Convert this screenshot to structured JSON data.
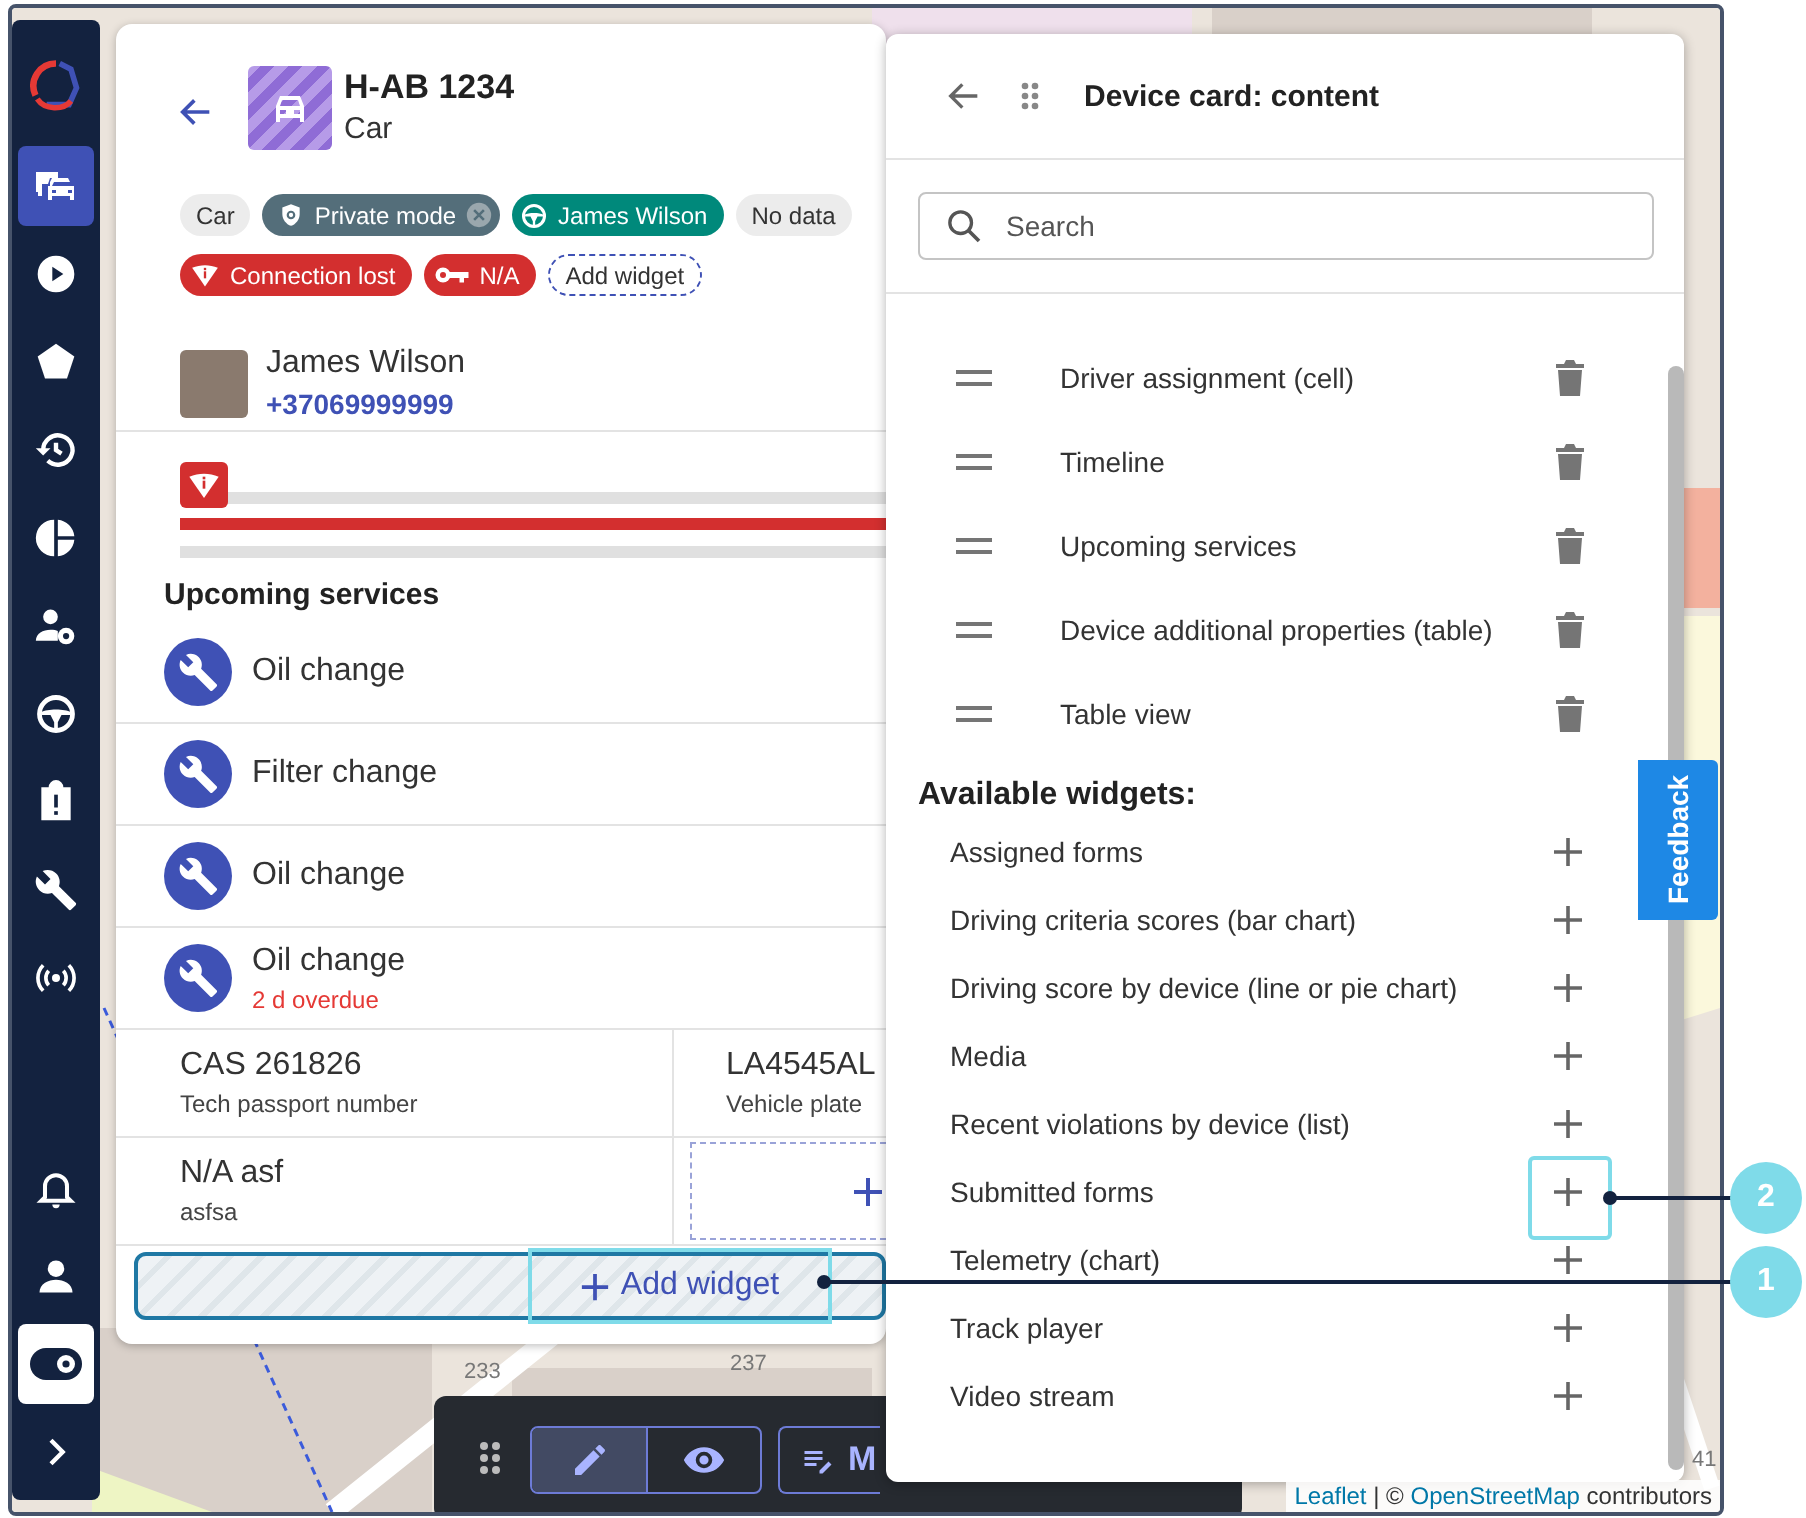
{
  "sidebar": {
    "top_items": [
      {
        "selected": true
      },
      {
        "selected": false
      },
      {
        "selected": false
      },
      {
        "selected": false
      },
      {
        "selected": false
      },
      {
        "selected": false
      },
      {
        "selected": false
      },
      {
        "selected": false
      },
      {
        "selected": false
      },
      {
        "selected": false
      }
    ],
    "bottom_items": [
      {
        "selected": false
      },
      {
        "selected": false
      },
      {
        "selected": true
      },
      {
        "selected": false
      }
    ]
  },
  "device_card": {
    "title": "H-AB 1234",
    "subtitle": "Car",
    "chip_rows": [
      {
        "chips": [
          {
            "kind": "plain",
            "label": "Car"
          },
          {
            "kind": "private",
            "label": "Private mode"
          },
          {
            "kind": "driver",
            "label": "James Wilson"
          },
          {
            "kind": "plain",
            "label": "No data"
          }
        ]
      },
      {
        "chips": [
          {
            "kind": "alert",
            "label": "Connection lost"
          },
          {
            "kind": "key",
            "label": "N/A"
          },
          {
            "kind": "add",
            "label": "Add widget"
          }
        ]
      }
    ],
    "driver": {
      "name": "James Wilson",
      "phone": "+37069999999"
    },
    "upcoming_services": {
      "title": "Upcoming services",
      "items": [
        {
          "name": "Oil change"
        },
        {
          "name": "Filter change"
        },
        {
          "name": "Oil change"
        },
        {
          "name": "Oil change",
          "overdue": "2 d overdue"
        }
      ]
    },
    "properties": [
      {
        "kind": "property",
        "value": "CAS 261826",
        "label": "Tech passport number"
      },
      {
        "kind": "property",
        "value": "LA4545AL",
        "label": "Vehicle plate"
      },
      {
        "kind": "property",
        "value": "N/A asf",
        "label": "asfsa"
      },
      {
        "kind": "add"
      }
    ],
    "add_widget_button": "Add widget"
  },
  "panel": {
    "title": "Device card: content",
    "search": {
      "placeholder": "Search"
    },
    "widgets": [
      "Driver assignment (cell)",
      "Timeline",
      "Upcoming services",
      "Device additional properties (table)",
      "Table view"
    ],
    "available_title": "Available widgets:",
    "available": [
      "Assigned forms",
      "Driving criteria scores (bar chart)",
      "Driving score by device (line or pie chart)",
      "Media",
      "Recent violations by device (list)",
      "Submitted forms",
      "Telemetry (chart)",
      "Track player",
      "Video stream"
    ]
  },
  "feedback": "Feedback",
  "toolbar": {
    "modes": [
      {
        "kind": "edit",
        "selected": true
      },
      {
        "kind": "view",
        "selected": false
      }
    ],
    "button_label": "M"
  },
  "map_labels": [
    "233",
    "237",
    "41"
  ],
  "attribution": [
    {
      "kind": "link",
      "text": "Leaflet"
    },
    {
      "kind": "text",
      "text": "| ©"
    },
    {
      "kind": "link",
      "text": "OpenStreetMap"
    },
    {
      "kind": "text",
      "text": "contributors"
    }
  ],
  "callouts": [
    {
      "number": "2"
    },
    {
      "number": "1"
    }
  ]
}
